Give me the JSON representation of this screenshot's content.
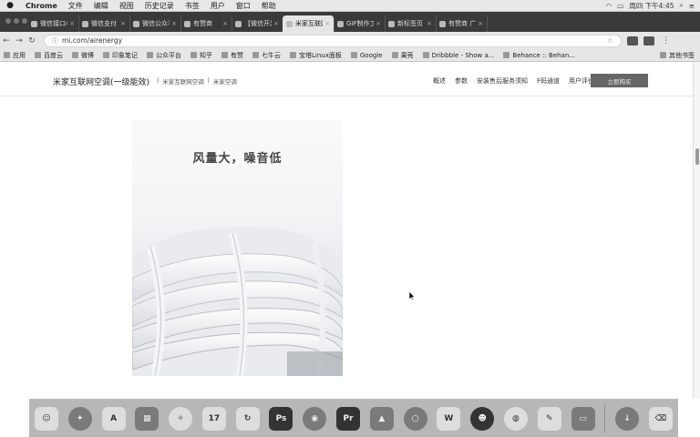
{
  "menubar": {
    "apple": "",
    "items": [
      "Chrome",
      "文件",
      "编辑",
      "视图",
      "历史记录",
      "书签",
      "用户",
      "窗口",
      "帮助"
    ],
    "clock": "周四 下午4:45"
  },
  "tabs": [
    {
      "label": "微信接口46",
      "active": false
    },
    {
      "label": "微信支付",
      "active": false
    },
    {
      "label": "微信公众平台",
      "active": false
    },
    {
      "label": "有赞商",
      "active": false
    },
    {
      "label": "【微信开发",
      "active": false
    },
    {
      "label": "米家互联网空",
      "active": true
    },
    {
      "label": "GIF制作工具",
      "active": false
    },
    {
      "label": "新标签页",
      "active": false
    },
    {
      "label": "有赞商 广告",
      "active": false
    }
  ],
  "addressbar": {
    "url": "mi.com/airenergy"
  },
  "bookmarks": {
    "items": [
      "应用",
      "百度云",
      "微博",
      "印象笔记",
      "公众平台",
      "知乎",
      "有赞",
      "七牛云",
      "宝塔Linux面板",
      "Google",
      "果壳",
      "Dribbble - Show a...",
      "Behance :: Behan..."
    ],
    "other": "其他书签"
  },
  "site": {
    "title": "米家互联网空调(一级能效)",
    "crumbs": [
      "米家互联网空调",
      "米家空调"
    ],
    "nav": [
      "概述",
      "参数",
      "安装售后服务须知",
      "F码通道",
      "用户评价"
    ],
    "buy_label": "立即购买"
  },
  "hero": {
    "headline": "风量大，噪音低"
  },
  "dock": {
    "icons": [
      "finder-icon",
      "launchpad-icon",
      "app-store-icon",
      "preview-icon",
      "safari-icon",
      "calendar-icon",
      "refresh-app-icon",
      "photoshop-icon",
      "chrome-icon",
      "premiere-icon",
      "keynote-icon",
      "circle-app-icon",
      "wps-icon",
      "qq-icon",
      "wechat-icon",
      "notes-icon",
      "screen-icon",
      "downloads-icon",
      "trash-icon"
    ],
    "calendar_day": "17",
    "photoshop_label": "Ps",
    "premiere_label": "Pr",
    "wps_label": "W"
  }
}
